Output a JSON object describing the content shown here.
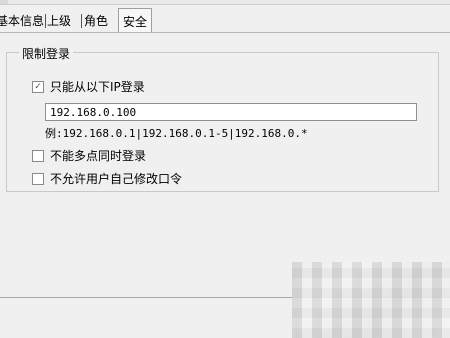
{
  "tabs": [
    {
      "label": "基本信息"
    },
    {
      "label": "上级"
    },
    {
      "label": "角色"
    },
    {
      "label": "安全"
    }
  ],
  "group": {
    "title": "限制登录",
    "only_ip": {
      "label": "只能从以下IP登录",
      "checked": true
    },
    "ip_value": "192.168.0.100",
    "ip_hint": "例:192.168.0.1|192.168.0.1-5|192.168.0.*",
    "no_multi_login": {
      "label": "不能多点同时登录",
      "checked": false
    },
    "no_change_password": {
      "label": "不允许用户自己修改口令",
      "checked": false
    }
  },
  "checkmark_glyph": "✓"
}
